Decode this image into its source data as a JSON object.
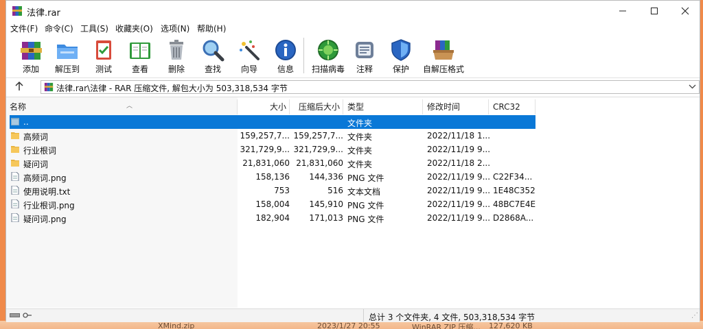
{
  "window": {
    "title": "法律.rar"
  },
  "menu": [
    "文件(F)",
    "命令(C)",
    "工具(S)",
    "收藏夹(O)",
    "选项(N)",
    "帮助(H)"
  ],
  "toolbar": [
    {
      "label": "添加",
      "icon": "add-archive-icon"
    },
    {
      "label": "解压到",
      "icon": "extract-to-icon"
    },
    {
      "label": "测试",
      "icon": "test-icon"
    },
    {
      "label": "查看",
      "icon": "view-icon"
    },
    {
      "label": "删除",
      "icon": "delete-icon"
    },
    {
      "label": "查找",
      "icon": "find-icon"
    },
    {
      "label": "向导",
      "icon": "wizard-icon"
    },
    {
      "label": "信息",
      "icon": "info-icon"
    },
    {
      "label": "扫描病毒",
      "icon": "scan-virus-icon"
    },
    {
      "label": "注释",
      "icon": "comment-icon"
    },
    {
      "label": "保护",
      "icon": "protect-icon"
    },
    {
      "label": "自解压格式",
      "icon": "sfx-icon"
    }
  ],
  "address": {
    "path": "法律.rar\\法律 - RAR 压缩文件, 解包大小为 503,318,534 字节"
  },
  "columns": {
    "name": "名称",
    "size": "大小",
    "packed": "压缩后大小",
    "type": "类型",
    "modified": "修改时间",
    "crc": "CRC32"
  },
  "files": [
    {
      "name": "..",
      "size": "",
      "packed": "",
      "type": "文件夹",
      "modified": "",
      "crc": "",
      "kind": "up"
    },
    {
      "name": "高频词",
      "size": "159,257,7...",
      "packed": "159,257,7...",
      "type": "文件夹",
      "modified": "2022/11/18 1...",
      "crc": "",
      "kind": "folder"
    },
    {
      "name": "行业根词",
      "size": "321,729,9...",
      "packed": "321,729,9...",
      "type": "文件夹",
      "modified": "2022/11/19 9...",
      "crc": "",
      "kind": "folder"
    },
    {
      "name": "疑问词",
      "size": "21,831,060",
      "packed": "21,831,060",
      "type": "文件夹",
      "modified": "2022/11/18 2...",
      "crc": "",
      "kind": "folder"
    },
    {
      "name": "高频词.png",
      "size": "158,136",
      "packed": "144,336",
      "type": "PNG 文件",
      "modified": "2022/11/19 9...",
      "crc": "C22F34...",
      "kind": "file"
    },
    {
      "name": "使用说明.txt",
      "size": "753",
      "packed": "516",
      "type": "文本文档",
      "modified": "2022/11/19 9...",
      "crc": "1E48C352",
      "kind": "file"
    },
    {
      "name": "行业根词.png",
      "size": "158,004",
      "packed": "145,910",
      "type": "PNG 文件",
      "modified": "2022/11/19 9...",
      "crc": "48BC7E4E",
      "kind": "file"
    },
    {
      "name": "疑问词.png",
      "size": "182,904",
      "packed": "171,013",
      "type": "PNG 文件",
      "modified": "2022/11/19 9...",
      "crc": "D2868A...",
      "kind": "file"
    }
  ],
  "status": {
    "text": "总计 3 个文件夹, 4 文件, 503,318,534 字节"
  },
  "background": {
    "name": "XMind.zip",
    "date": "2023/1/27 20:55",
    "type": "WinRAR ZIP 压缩...",
    "size": "127,620 KB"
  },
  "colors": {
    "selection": "#0a78d7",
    "desktop": "#f4a26a",
    "folder": "#f6c75a"
  }
}
